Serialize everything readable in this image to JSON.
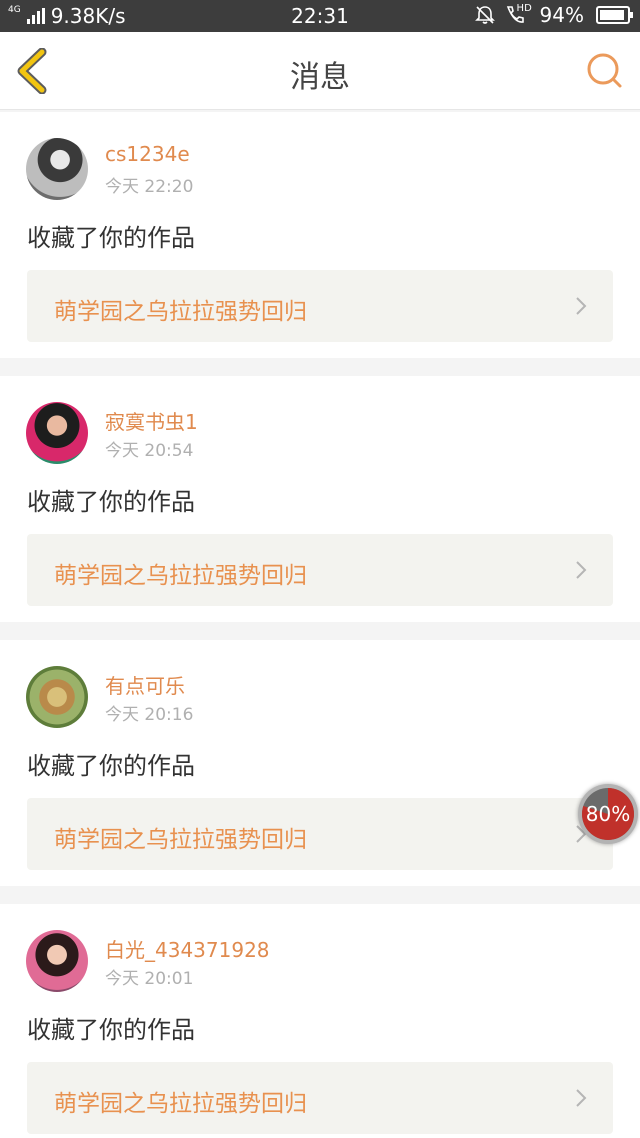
{
  "status_bar": {
    "network_type": "4G",
    "speed": "9.38K/s",
    "time": "22:31",
    "hd_label": "HD",
    "battery": "94%",
    "battery_level": 0.94
  },
  "nav": {
    "title": "消息",
    "back_icon": "chevron-left-icon",
    "search_icon": "search-icon"
  },
  "messages": [
    {
      "username": "cs1234e",
      "time": "今天 22:20",
      "action": "收藏了你的作品",
      "work_title": "萌学园之乌拉拉强势回归"
    },
    {
      "username": "寂寞书虫1",
      "time": "今天 20:54",
      "action": "收藏了你的作品",
      "work_title": "萌学园之乌拉拉强势回归"
    },
    {
      "username": "有点可乐",
      "time": "今天 20:16",
      "action": "收藏了你的作品",
      "work_title": "萌学园之乌拉拉强势回归"
    },
    {
      "username": "白光_434371928",
      "time": "今天 20:01",
      "action": "收藏了你的作品",
      "work_title": "萌学园之乌拉拉强势回归"
    }
  ],
  "floating_badge": {
    "label": "80%",
    "value": 0.8
  },
  "colors": {
    "accent": "#e8914f",
    "back_icon": "#f2c511",
    "status_bar": "#3d3d3d"
  }
}
